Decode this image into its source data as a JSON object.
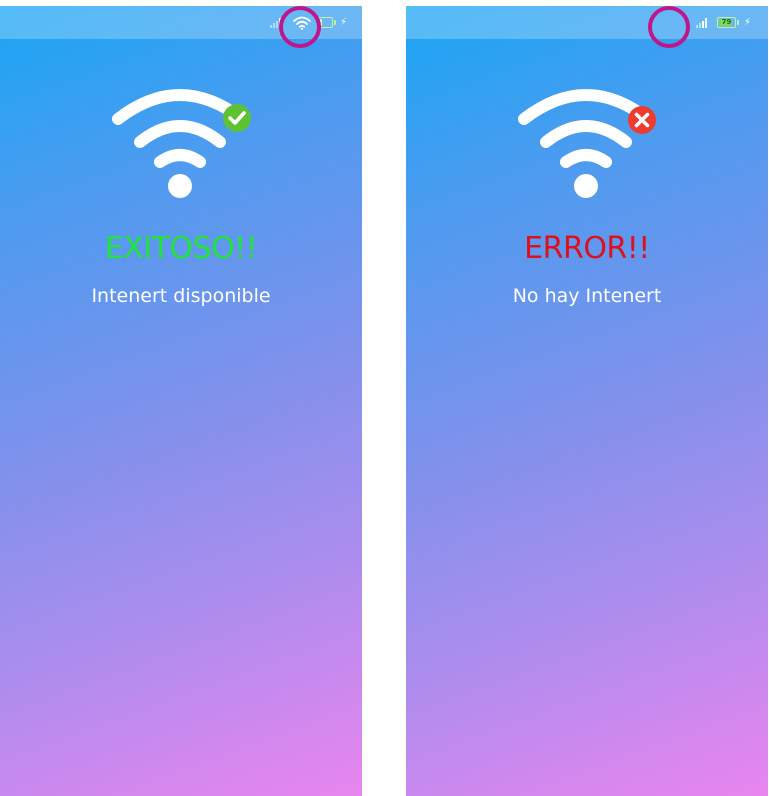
{
  "screens": {
    "success": {
      "title": "EXITOSO!!",
      "subtitle": "Intenert disponible",
      "title_color": "#22e33a",
      "badge_color": "#5ec232",
      "badge_icon": "check-icon",
      "status_icons": [
        "cellular-signal-icon",
        "wifi-icon",
        "battery-icon",
        "charging-bolt-icon"
      ],
      "battery_level": ""
    },
    "error": {
      "title": "ERROR!!",
      "subtitle": "No hay Intenert",
      "title_color": "#e0101a",
      "badge_color": "#ee3b2f",
      "badge_icon": "close-icon",
      "status_icons": [
        "cellular-signal-icon",
        "battery-icon",
        "charging-bolt-icon"
      ],
      "battery_level": "79"
    }
  },
  "colors": {
    "gradient_top": "#19a6f4",
    "gradient_bottom": "#e985ef",
    "highlight_ring": "#c0168d",
    "wifi_arcs": "#ffffff"
  }
}
